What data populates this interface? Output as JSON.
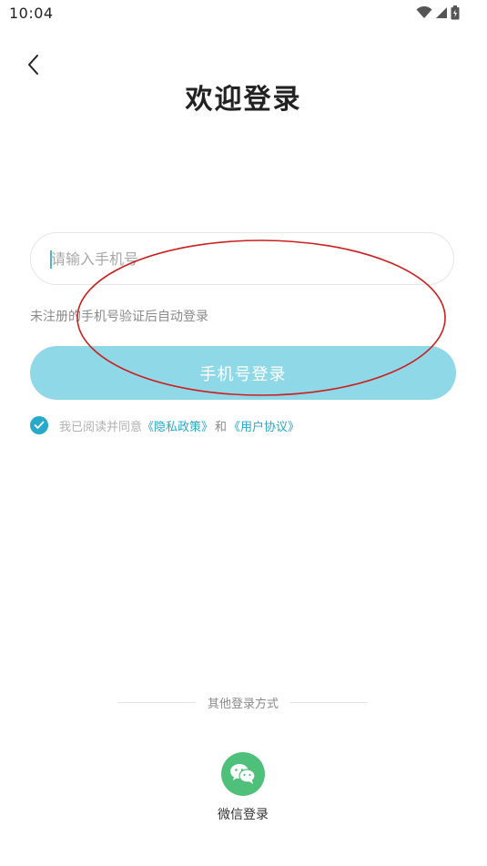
{
  "status_bar": {
    "time": "10:04",
    "icons": [
      "wifi-icon",
      "cell-signal-icon",
      "battery-icon"
    ]
  },
  "header": {
    "back_icon": "chevron-left-icon",
    "title": "欢迎登录"
  },
  "login_form": {
    "phone_input": {
      "value": "",
      "placeholder": "请输入手机号"
    },
    "hint": "未注册的手机号验证后自动登录",
    "submit_label": "手机号登录",
    "agreement": {
      "checked": true,
      "prefix": "我已阅读并同意",
      "privacy_link": "《隐私政策》",
      "and": "和",
      "terms_link": "《用户协议》"
    }
  },
  "other_login": {
    "label": "其他登录方式",
    "wechat": {
      "icon": "wechat-icon",
      "label": "微信登录"
    }
  },
  "colors": {
    "accent": "#27a9c9",
    "button_bg": "#8ed8e8",
    "wechat_green": "#4fc07a",
    "annotation_red": "#cc1f1f"
  }
}
